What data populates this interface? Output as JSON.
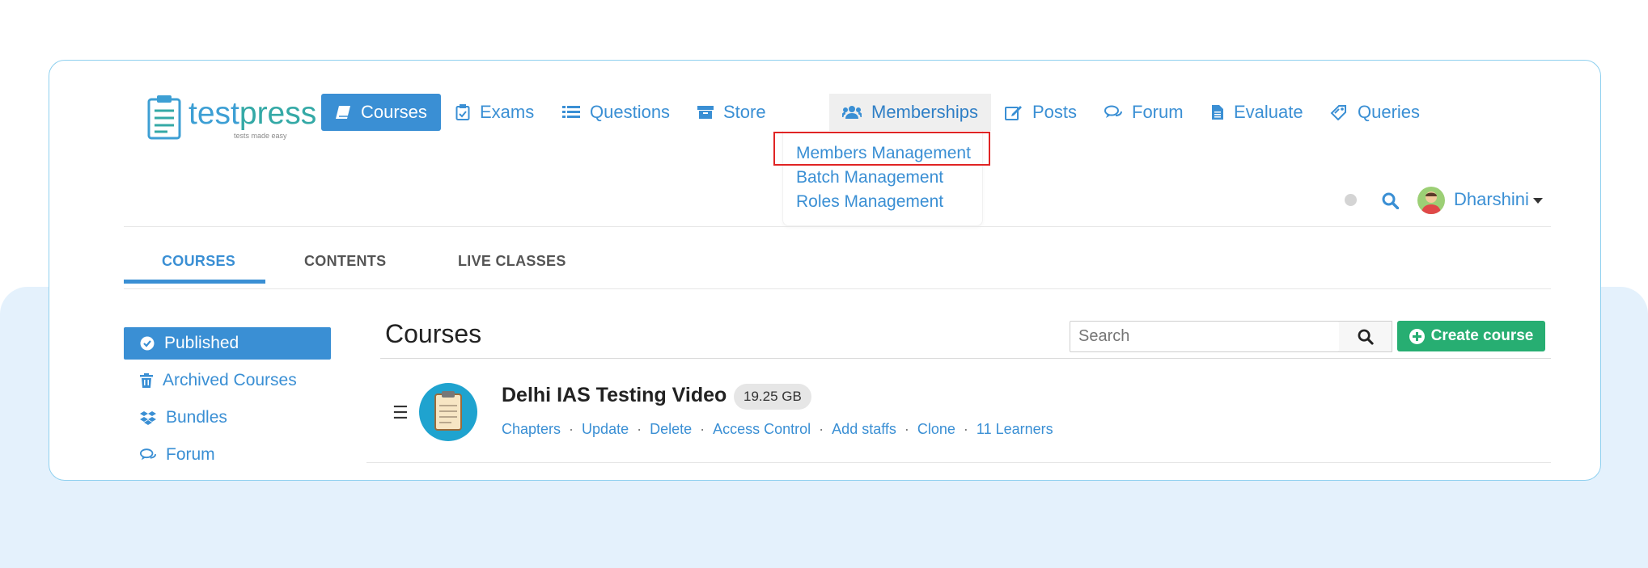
{
  "logo": {
    "text_part1": "test",
    "text_part2": "press",
    "tagline": "tests made easy"
  },
  "nav": {
    "courses": "Courses",
    "exams": "Exams",
    "questions": "Questions",
    "store": "Store",
    "memberships": "Memberships",
    "posts": "Posts",
    "forum": "Forum",
    "evaluate": "Evaluate",
    "queries": "Queries"
  },
  "memberships_menu": {
    "items": [
      "Members Management",
      "Batch Management",
      "Roles Management"
    ]
  },
  "user": {
    "name": "Dharshini"
  },
  "tabs": [
    "COURSES",
    "CONTENTS",
    "LIVE CLASSES"
  ],
  "sidebar": {
    "items": [
      "Published",
      "Archived Courses",
      "Bundles",
      "Forum"
    ]
  },
  "main": {
    "title": "Courses",
    "search_placeholder": "Search",
    "create_label": "Create course"
  },
  "course": {
    "name": "Delhi IAS Testing Video",
    "size": "19.25 GB",
    "actions": [
      "Chapters",
      "Update",
      "Delete",
      "Access Control",
      "Add staffs",
      "Clone",
      "11 Learners"
    ]
  },
  "colors": {
    "primary": "#3a8fd4",
    "success": "#27ae72",
    "highlight": "#e02424",
    "band": "#e4f1fc"
  }
}
